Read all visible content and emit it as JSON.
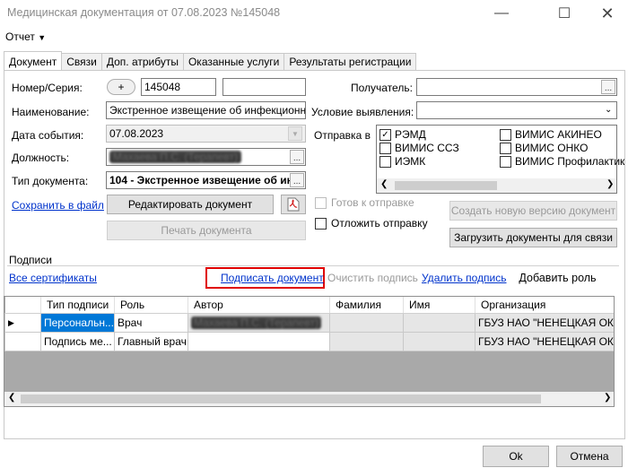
{
  "window": {
    "title": "Медицинская документация от 07.08.2023 №145048"
  },
  "menu": {
    "report": "Отчет"
  },
  "tabs": [
    "Документ",
    "Связи",
    "Доп. атрибуты",
    "Оказанные услуги",
    "Результаты регистрации"
  ],
  "form": {
    "number_label": "Номер/Серия:",
    "plus": "+",
    "number_value": "145048",
    "name_label": "Наименование:",
    "name_value": "Экстренное извещение об инфекционном заб",
    "date_label": "Дата события:",
    "date_value": "07.08.2023",
    "position_label": "Должность:",
    "position_value": "Махаева П.С. (Терапевт)",
    "doctype_label": "Тип документа:",
    "doctype_value": "104 - Экстренное извещение об ин",
    "save_link": "Сохранить в файл",
    "edit_button": "Редактировать документ",
    "print_button": "Печать документа",
    "recipient_label": "Получатель:",
    "condition_label": "Условие выявления:",
    "send_label": "Отправка в",
    "send_items": [
      {
        "label": "РЭМД",
        "checked": true
      },
      {
        "label": "ВИМИС АКИНЕО",
        "checked": false
      },
      {
        "label": "ВИМИС ССЗ",
        "checked": false
      },
      {
        "label": "ВИМИС ОНКО",
        "checked": false
      },
      {
        "label": "ИЭМК",
        "checked": false
      },
      {
        "label": "ВИМИС Профилактик",
        "checked": false
      }
    ],
    "ready_label": "Готов к отправке",
    "postpone_label": "Отложить отправку",
    "new_version_button": "Создать новую версию документ",
    "load_docs_button": "Загрузить документы для связи"
  },
  "signatures": {
    "title": "Подписи",
    "all_certs": "Все сертификаты",
    "sign_doc": "Подписать документ",
    "clear_sign": "Очистить подпись",
    "delete_sign": "Удалить подпись",
    "add_role": "Добавить роль",
    "columns": [
      "Тип подписи",
      "Роль",
      "Автор",
      "Фамилия",
      "Имя",
      "Организация"
    ],
    "rows": [
      [
        "Персональн...",
        "Врач",
        "Махаева П.С. (Терапевт)",
        "",
        "",
        "ГБУЗ НАО \"НЕНЕЦКАЯ ОК..."
      ],
      [
        "Подпись ме...",
        "Главный врач",
        "",
        "",
        "",
        "ГБУЗ НАО \"НЕНЕЦКАЯ ОК..."
      ]
    ]
  },
  "footer": {
    "ok": "Ok",
    "cancel": "Отмена"
  },
  "colors": {
    "highlight": "#e00000",
    "selection": "#0078d7",
    "link": "#0033cc"
  }
}
